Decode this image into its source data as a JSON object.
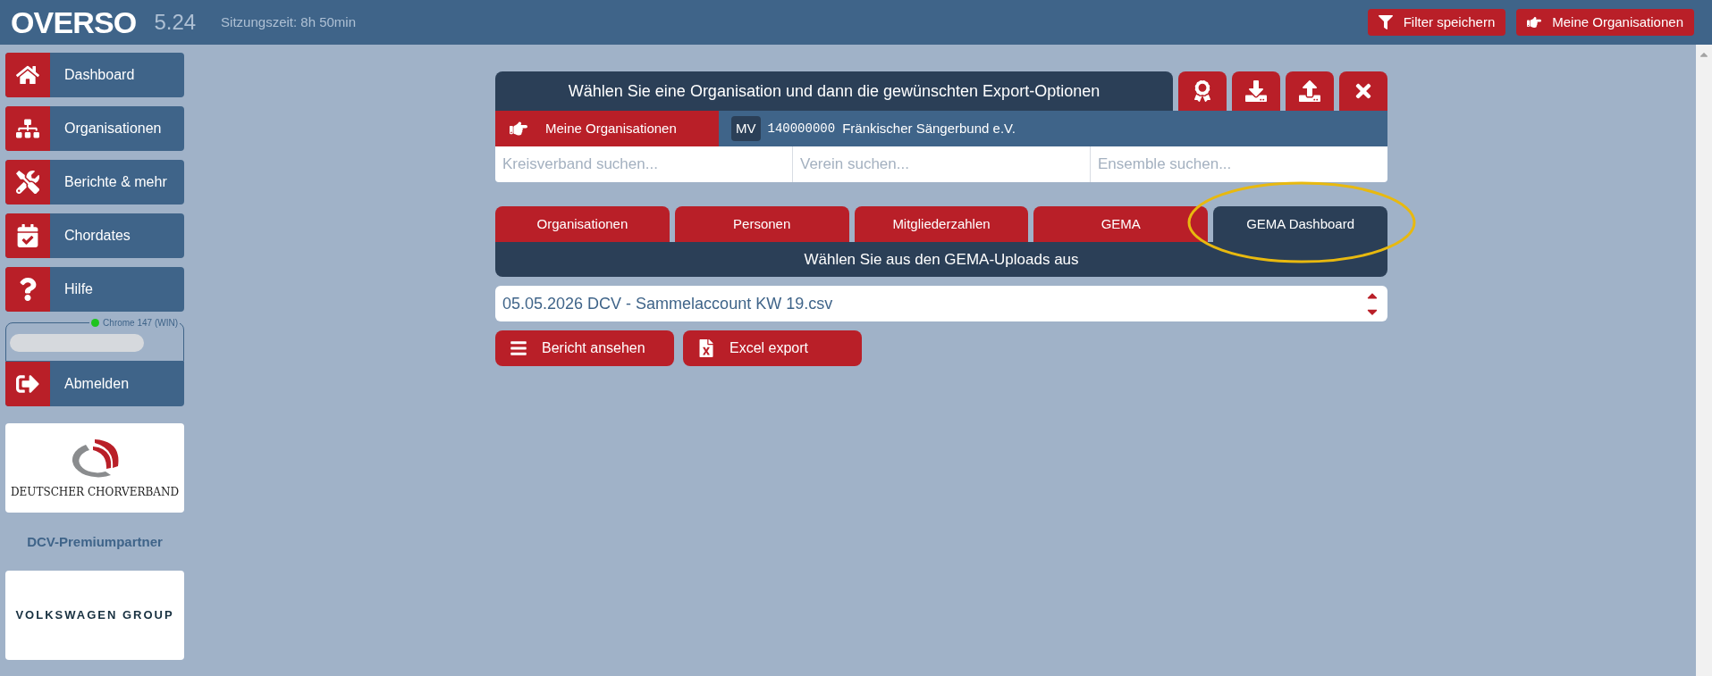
{
  "header": {
    "logo": "OVERSO",
    "version": "5.24",
    "session": "Sitzungszeit: 8h 50min"
  },
  "header_buttons": [
    {
      "label": "Filter speichern",
      "kind": "filter"
    },
    {
      "label": "Meine Organisationen",
      "kind": "hand"
    }
  ],
  "sidebar": {
    "items": [
      {
        "label": "Dashboard",
        "kind": "home"
      },
      {
        "label": "Organisationen",
        "kind": "sitemap"
      },
      {
        "label": "Berichte & mehr",
        "kind": "tools"
      },
      {
        "label": "Chordates",
        "kind": "calendar"
      },
      {
        "label": "Hilfe",
        "kind": "help"
      }
    ],
    "browser": "Chrome 147 (WIN)",
    "online": true,
    "logout": "Abmelden",
    "logo_text": "DEUTSCHER CHORVERBAND",
    "partner_label": "DCV-Premiumpartner",
    "partner_logo": "VOLKSWAGEN GROUP"
  },
  "panel": {
    "title": "Wählen Sie eine Organisation und dann die gewünschten Export-Optionen",
    "actions": [
      {
        "kind": "award"
      },
      {
        "kind": "download"
      },
      {
        "kind": "upload"
      },
      {
        "kind": "close"
      }
    ],
    "org_button": "Meine Organisationen",
    "org": {
      "badge": "MV",
      "number": "140000000",
      "name": "Fränkischer Sängerbund e.V."
    },
    "search_fields": [
      {
        "placeholder": "Kreisverband suchen..."
      },
      {
        "placeholder": "Verein suchen..."
      },
      {
        "placeholder": "Ensemble suchen..."
      }
    ],
    "tabs": [
      {
        "label": "Organisationen",
        "selected": false
      },
      {
        "label": "Personen",
        "selected": false
      },
      {
        "label": "Mitgliederzahlen",
        "selected": false
      },
      {
        "label": "GEMA",
        "selected": false
      },
      {
        "label": "GEMA Dashboard",
        "selected": true
      }
    ],
    "subtitle": "Wählen Sie aus den GEMA-Uploads aus",
    "select": {
      "value": "05.05.2026 DCV - Sammelaccount KW 19.csv"
    },
    "buttons": [
      {
        "label": "Bericht ansehen",
        "kind": "list"
      },
      {
        "label": "Excel export",
        "kind": "excel"
      }
    ]
  }
}
